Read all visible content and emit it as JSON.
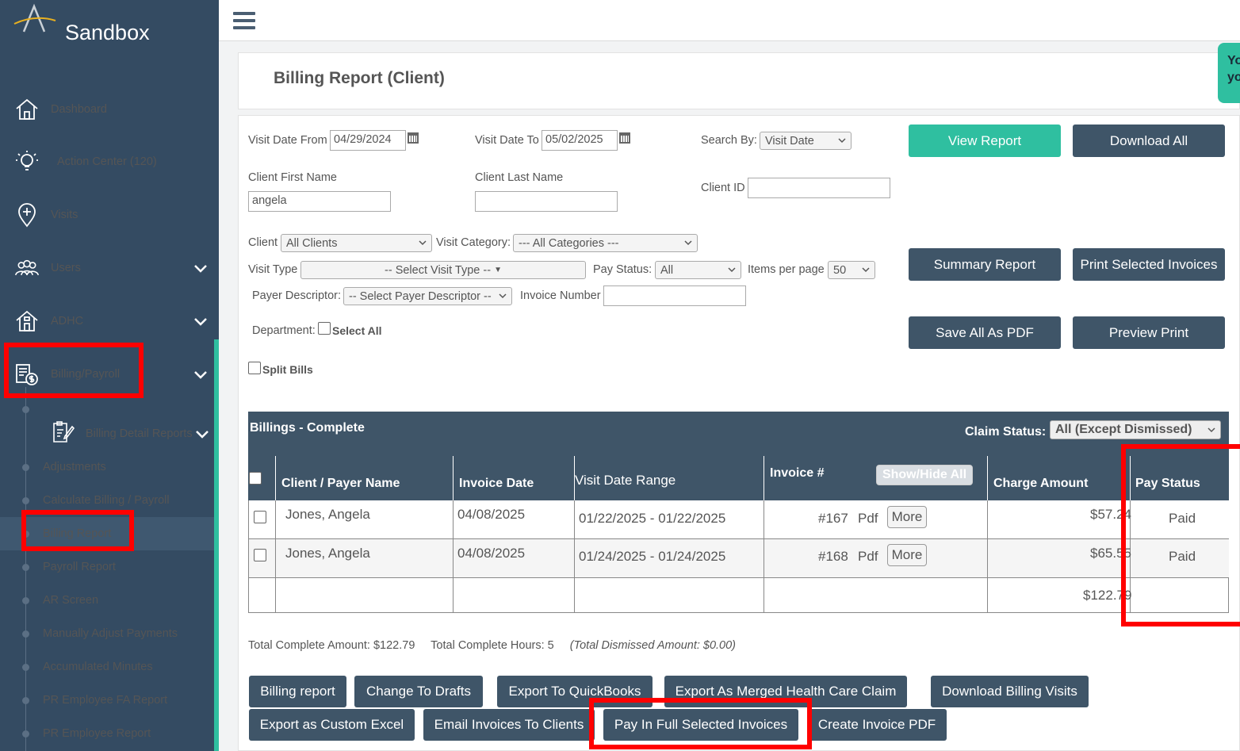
{
  "brand": {
    "name": "Sandbox"
  },
  "sidebar": {
    "items": [
      {
        "label": "Dashboard",
        "icon": "home-icon"
      },
      {
        "label": "Action Center (120)",
        "icon": "lightbulb-icon"
      },
      {
        "label": "Visits",
        "icon": "map-pin-plus-icon"
      },
      {
        "label": "Users",
        "icon": "users-icon"
      },
      {
        "label": "ADHC",
        "icon": "building-icon"
      },
      {
        "label": "Billing/Payroll",
        "icon": "billing-icon"
      }
    ],
    "sub_items": [
      {
        "label": "Billing Detail Reports"
      },
      {
        "label": "Adjustments"
      },
      {
        "label": "Calculate Billing / Payroll"
      },
      {
        "label": "Billing Report"
      },
      {
        "label": "Payroll Report"
      },
      {
        "label": "AR Screen"
      },
      {
        "label": "Manually Adjust Payments"
      },
      {
        "label": "Accumulated Minutes"
      },
      {
        "label": "PR Employee FA Report"
      },
      {
        "label": "PR Employee Report"
      }
    ]
  },
  "page": {
    "title": "Billing Report (Client)",
    "help_tab": "Yo yo"
  },
  "filters": {
    "visit_date_from_label": "Visit Date From",
    "visit_date_from": "04/29/2024",
    "visit_date_to_label": "Visit Date To",
    "visit_date_to": "05/02/2025",
    "search_by_label": "Search By:",
    "search_by": "Visit Date",
    "client_first_name_label": "Client First Name",
    "client_first_name": "angela",
    "client_last_name_label": "Client Last Name",
    "client_last_name": "",
    "client_id_label": "Client ID",
    "client_id": "",
    "client_label": "Client",
    "client": "All Clients",
    "visit_category_label": "Visit Category:",
    "visit_category": "--- All Categories ---",
    "visit_type_label": "Visit Type",
    "visit_type": "-- Select Visit Type --",
    "pay_status_label": "Pay Status:",
    "pay_status": "All",
    "items_per_page_label": "Items per page",
    "items_per_page": "50",
    "payer_descriptor_label": "Payer Descriptor:",
    "payer_descriptor": "-- Select Payer Descriptor --",
    "invoice_number_label": "Invoice Number",
    "invoice_number": "",
    "department_label": "Department:",
    "select_all_label": "Select All",
    "split_bills_label": "Split Bills"
  },
  "actions": {
    "view_report": "View Report",
    "download_all": "Download All",
    "summary_report": "Summary Report",
    "print_selected": "Print Selected Invoices",
    "save_all_pdf": "Save All As PDF",
    "preview_print": "Preview Print"
  },
  "table": {
    "title": "Billings - Complete",
    "claim_status_label": "Claim Status:",
    "claim_status": "All (Except Dismissed)",
    "show_hide_label": "Show/Hide All",
    "columns": [
      "Client / Payer Name",
      "Invoice Date",
      "Visit Date Range",
      "Invoice #",
      "Charge Amount",
      "Pay Status"
    ],
    "rows": [
      {
        "name": "Jones, Angela",
        "invoice_date": "04/08/2025",
        "range": "01/22/2025 - 01/22/2025",
        "invoice": "#167",
        "pdf": "Pdf",
        "more": "More",
        "amount": "$57.24",
        "status": "Paid"
      },
      {
        "name": "Jones, Angela",
        "invoice_date": "04/08/2025",
        "range": "01/24/2025 - 01/24/2025",
        "invoice": "#168",
        "pdf": "Pdf",
        "more": "More",
        "amount": "$65.55",
        "status": "Paid"
      }
    ],
    "total_amount": "$122.79"
  },
  "totals": {
    "amount": "Total Complete Amount: $122.79",
    "hours": "Total Complete Hours: 5",
    "dismissed": "(Total Dismissed Amount: $0.00)"
  },
  "bottom_buttons": {
    "billing_report": "Billing report",
    "change_drafts": "Change To Drafts",
    "export_qb": "Export To QuickBooks",
    "export_merged": "Export As Merged Health Care Claim",
    "download_visits": "Download Billing Visits",
    "export_excel": "Export as Custom Excel",
    "email_invoices": "Email Invoices To Clients",
    "pay_in_full": "Pay In Full Selected Invoices",
    "create_pdf": "Create Invoice PDF"
  },
  "colors": {
    "sidebar": "#344b62",
    "accent": "#2fbfa0",
    "button": "#3f5568",
    "highlight": "#ff0000"
  }
}
